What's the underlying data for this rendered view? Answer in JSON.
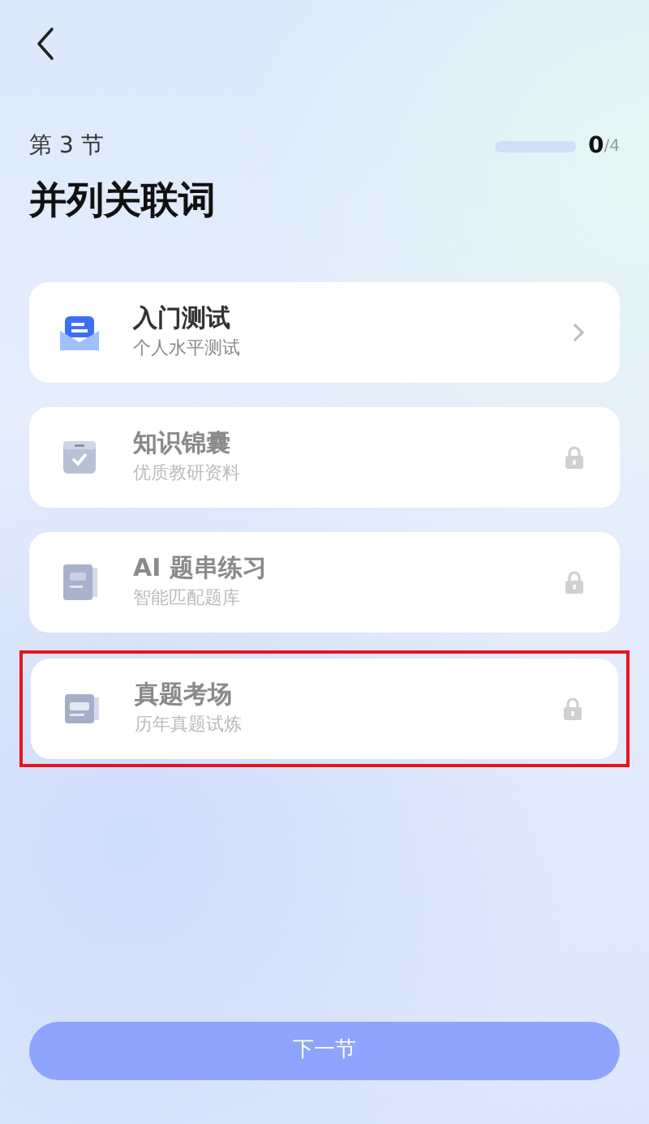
{
  "header": {
    "section": "第 3 节",
    "title": "并列关联词",
    "progress": {
      "level": 0,
      "done": "0",
      "total": "/4"
    }
  },
  "items": [
    {
      "kind": "test",
      "title": "入门测试",
      "subtitle": "个人水平测试",
      "locked": false,
      "highlighted": false
    },
    {
      "kind": "materials",
      "title": "知识锦囊",
      "subtitle": "优质教研资料",
      "locked": true,
      "highlighted": false
    },
    {
      "kind": "ai",
      "title": "AI 题串练习",
      "subtitle": "智能匹配题库",
      "locked": true,
      "highlighted": false
    },
    {
      "kind": "exam",
      "title": "真题考场",
      "subtitle": "历年真题试炼",
      "locked": true,
      "highlighted": true
    }
  ],
  "next_button": {
    "label": "下一节",
    "disabled": true
  }
}
